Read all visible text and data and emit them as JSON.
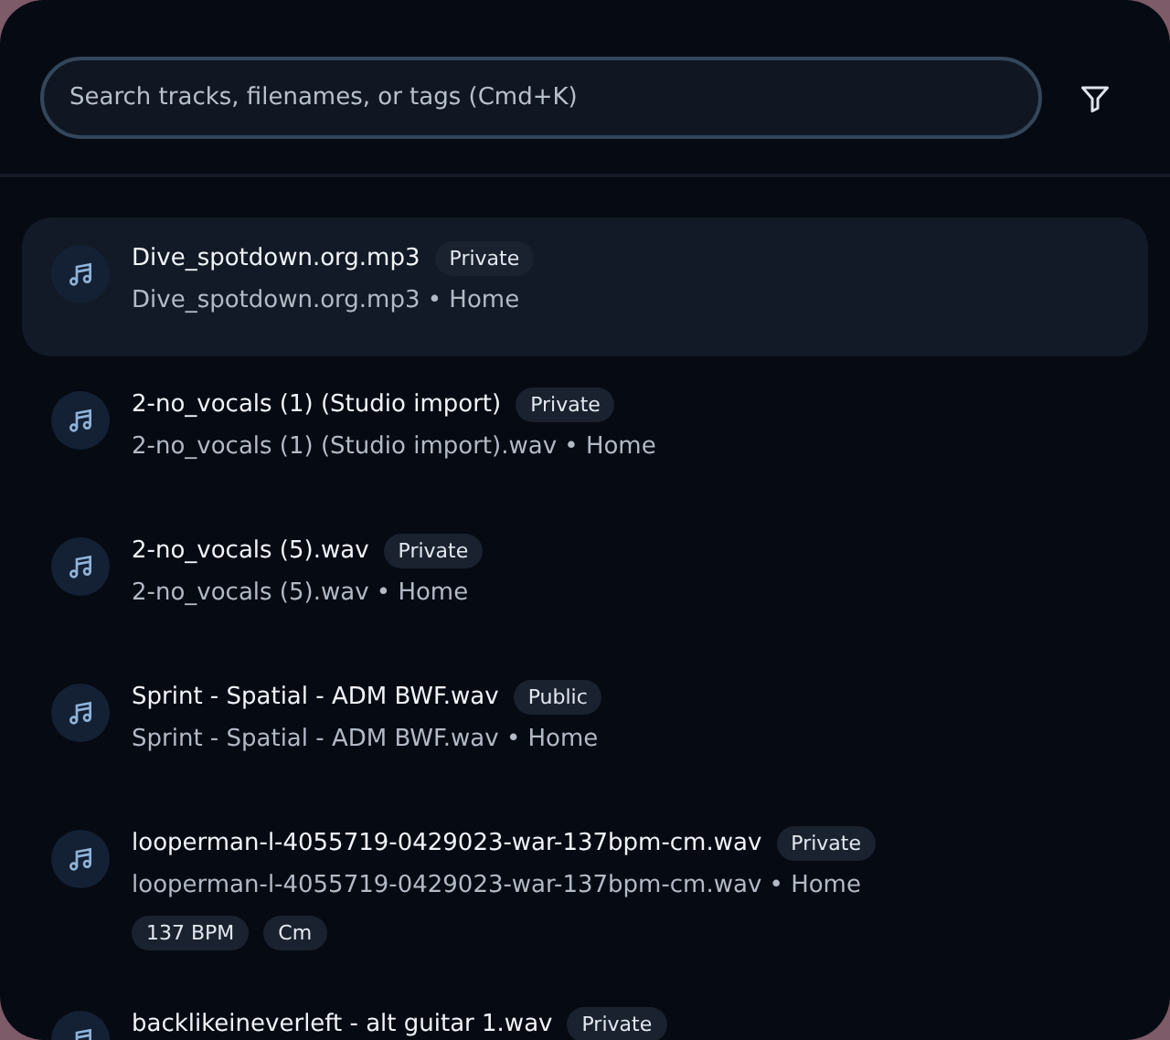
{
  "search": {
    "placeholder": "Search tracks, filenames, or tags (Cmd+K)"
  },
  "tracks": [
    {
      "title": "Dive_spotdown.org.mp3",
      "visibility": "Private",
      "subtitle": "Dive_spotdown.org.mp3 • Home",
      "selected": true
    },
    {
      "title": "2-no_vocals (1) (Studio import)",
      "visibility": "Private",
      "subtitle": "2-no_vocals (1) (Studio import).wav • Home",
      "selected": false
    },
    {
      "title": "2-no_vocals (5).wav",
      "visibility": "Private",
      "subtitle": "2-no_vocals (5).wav • Home",
      "selected": false
    },
    {
      "title": "Sprint - Spatial - ADM BWF.wav",
      "visibility": "Public",
      "subtitle": "Sprint - Spatial - ADM BWF.wav • Home",
      "selected": false
    },
    {
      "title": "looperman-l-4055719-0429023-war-137bpm-cm.wav",
      "visibility": "Private",
      "subtitle": "looperman-l-4055719-0429023-war-137bpm-cm.wav • Home",
      "selected": false,
      "tags": [
        "137 BPM",
        "Cm"
      ]
    },
    {
      "title": "backlikeineverleft - alt guitar 1.wav",
      "visibility": "Private",
      "selected": false
    }
  ]
}
